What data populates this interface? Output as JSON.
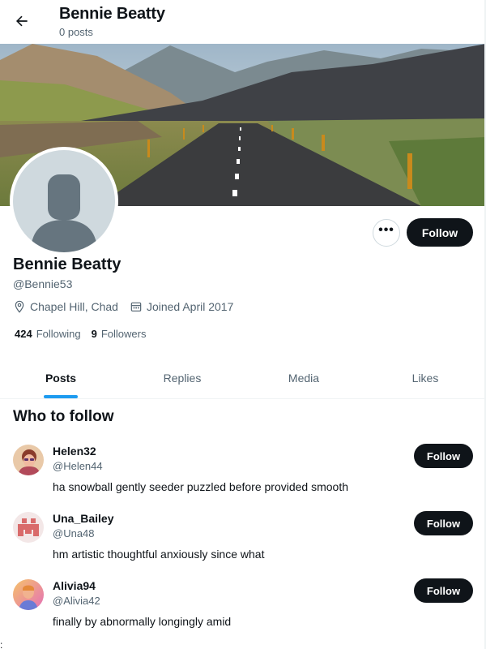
{
  "header": {
    "name": "Bennie Beatty",
    "post_count": "0 posts"
  },
  "profile": {
    "name": "Bennie Beatty",
    "handle": "@Bennie53",
    "location": "Chapel Hill, Chad",
    "joined": "Joined April 2017",
    "following_count": "424",
    "following_label": "Following",
    "followers_count": "9",
    "followers_label": "Followers",
    "follow_label": "Follow",
    "more_label": "•••"
  },
  "tabs": [
    {
      "label": "Posts",
      "active": true
    },
    {
      "label": "Replies",
      "active": false
    },
    {
      "label": "Media",
      "active": false
    },
    {
      "label": "Likes",
      "active": false
    }
  ],
  "who_to_follow": {
    "title": "Who to follow",
    "users": [
      {
        "name": "Helen32",
        "handle": "@Helen44",
        "bio": "ha snowball gently seeder puzzled before provided smooth",
        "follow_label": "Follow"
      },
      {
        "name": "Una_Bailey",
        "handle": "@Una48",
        "bio": "hm artistic thoughtful anxiously since what",
        "follow_label": "Follow"
      },
      {
        "name": "Alivia94",
        "handle": "@Alivia42",
        "bio": "finally by abnormally longingly amid",
        "follow_label": "Follow"
      }
    ]
  },
  "footer_mark": ":",
  "colors": {
    "accent": "#1d9bf0",
    "button_dark": "#0f1419",
    "muted_text": "#536471"
  }
}
